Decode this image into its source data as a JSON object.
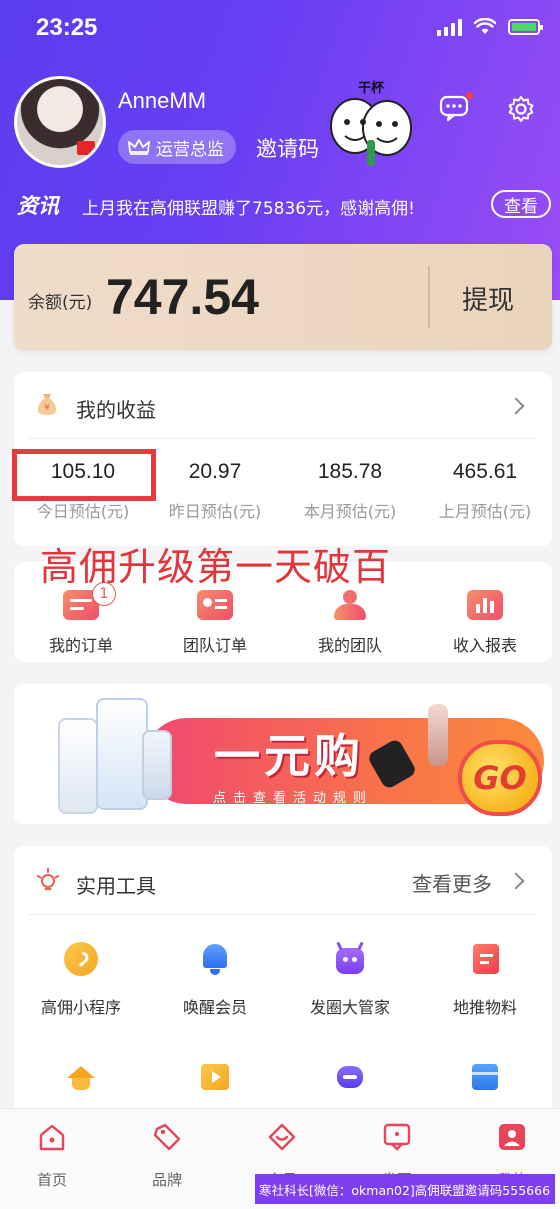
{
  "status_bar": {
    "time": "23:25"
  },
  "profile": {
    "username": "AnneMM",
    "role": "运营总监",
    "invite_label": "邀请码",
    "meme_caption": "干杯"
  },
  "news": {
    "tag": "资讯",
    "text": "上月我在高佣联盟赚了75836元，感谢高佣!",
    "button": "查看"
  },
  "balance": {
    "label": "余额(元)",
    "value": "747.54",
    "withdraw_label": "提现"
  },
  "earnings": {
    "title": "我的收益",
    "stats": [
      {
        "value": "105.10",
        "label": "今日预估(元)"
      },
      {
        "value": "20.97",
        "label": "昨日预估(元)"
      },
      {
        "value": "185.78",
        "label": "本月预估(元)"
      },
      {
        "value": "465.61",
        "label": "上月预估(元)"
      }
    ]
  },
  "annotation_text": "高佣升级第一天破百",
  "quick_menu": [
    {
      "label": "我的订单",
      "badge": "1"
    },
    {
      "label": "团队订单"
    },
    {
      "label": "我的团队"
    },
    {
      "label": "收入报表"
    }
  ],
  "banner": {
    "title": "一元购",
    "subtitle": "点击查看活动规则",
    "go": "GO"
  },
  "tools": {
    "title": "实用工具",
    "more": "查看更多",
    "items": [
      {
        "label": "高佣小程序",
        "icon": "miniprogram-icon",
        "color": "#f5a623"
      },
      {
        "label": "唤醒会员",
        "icon": "bell-icon",
        "color": "#3a7cf0"
      },
      {
        "label": "发圈大管家",
        "icon": "robot-icon",
        "color": "#8b4cf5"
      },
      {
        "label": "地推物料",
        "icon": "document-icon",
        "color": "#f0484c"
      },
      {
        "label": "",
        "icon": "graduation-cap-icon",
        "color": "#f5a623"
      },
      {
        "label": "",
        "icon": "video-icon",
        "color": "#f5a623"
      },
      {
        "label": "",
        "icon": "chat-bot-icon",
        "color": "#6f4cf0"
      },
      {
        "label": "",
        "icon": "wallet-icon",
        "color": "#2f86f0"
      }
    ]
  },
  "tabbar": [
    {
      "label": "首页",
      "icon": "home-icon"
    },
    {
      "label": "品牌",
      "icon": "tag-icon"
    },
    {
      "label": "会员",
      "icon": "member-icon"
    },
    {
      "label": "发圈",
      "icon": "message-icon"
    },
    {
      "label": "我的",
      "icon": "profile-icon"
    }
  ],
  "watermark": "寒社科长[微信：okman02]高佣联盟邀请码555666",
  "colors": {
    "header_start": "#5b3cf0",
    "header_end": "#9a4df5",
    "accent_red": "#e73a40",
    "balance_card": "#efdcc9"
  }
}
